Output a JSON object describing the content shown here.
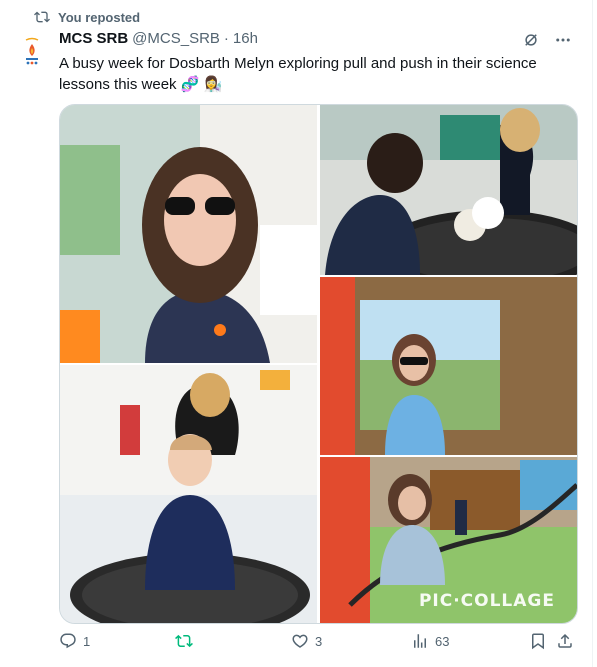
{
  "repost": {
    "label": "You reposted",
    "icon": "repost-icon"
  },
  "author": {
    "name": "MCS SRB",
    "handle": "@MCS_SRB",
    "separator": "·",
    "time": "16h"
  },
  "text": {
    "body": "A busy week for Dosbarth Melyn exploring pull and push in their science lessons this week",
    "emojis": "🧬 👩‍🔬"
  },
  "media": {
    "watermark": "PIC·COLLAGE",
    "photos": [
      {
        "description_icon": "photo-girl-sunglasses"
      },
      {
        "description_icon": "photo-footballs-trampoline"
      },
      {
        "description_icon": "photo-boy-trampoline"
      },
      {
        "description_icon": "photo-girl-mirror"
      },
      {
        "description_icon": "photo-girl-rope"
      }
    ]
  },
  "actions": {
    "reply_count": "1",
    "repost_count": "",
    "like_count": "3",
    "views_count": "63"
  },
  "colors": {
    "repost_green": "#00ba7c",
    "muted": "#536471",
    "text": "#0f1419",
    "border": "#cfd9de"
  }
}
